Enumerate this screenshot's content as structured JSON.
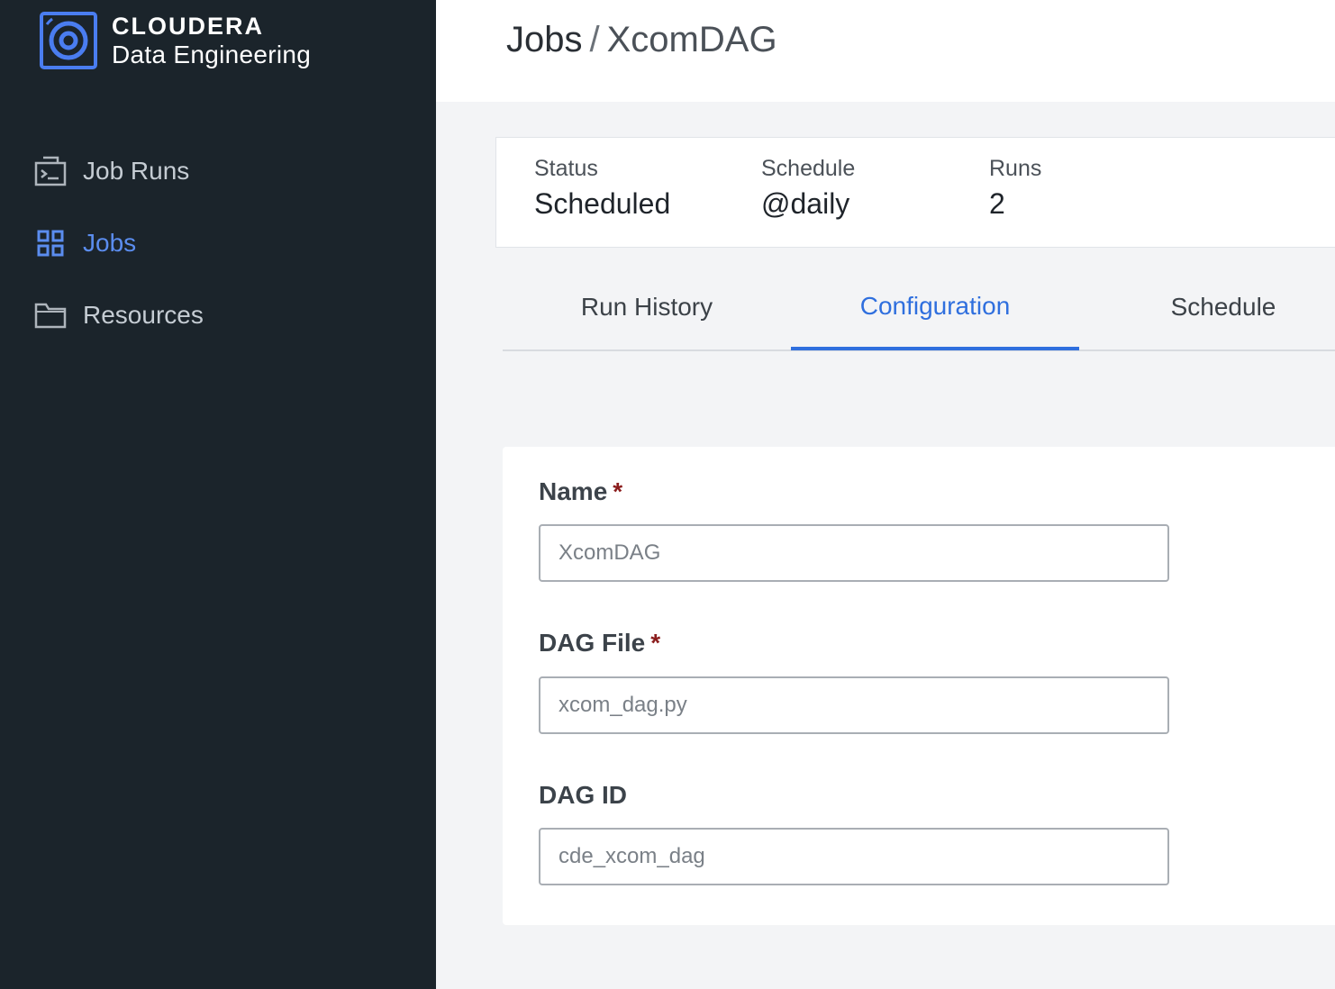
{
  "brand": {
    "name": "CLOUDERA",
    "product": "Data Engineering",
    "color": "#4a7df0"
  },
  "sidebar": {
    "items": [
      {
        "label": "Job Runs",
        "icon": "terminal-window-icon",
        "active": false
      },
      {
        "label": "Jobs",
        "icon": "grid-icon",
        "active": true
      },
      {
        "label": "Resources",
        "icon": "folder-icon",
        "active": false
      }
    ]
  },
  "header": {
    "parent": "Jobs",
    "separator": "/",
    "current": "XcomDAG"
  },
  "summary": {
    "status_label": "Status",
    "status_value": "Scheduled",
    "schedule_label": "Schedule",
    "schedule_value": "@daily",
    "runs_label": "Runs",
    "runs_value": "2"
  },
  "tabs": [
    {
      "label": "Run History",
      "active": false
    },
    {
      "label": "Configuration",
      "active": true
    },
    {
      "label": "Schedule",
      "active": false
    }
  ],
  "form": {
    "name_label": "Name",
    "name_required": "*",
    "name_value": "XcomDAG",
    "dag_file_label": "DAG File",
    "dag_file_required": "*",
    "dag_file_value": "xcom_dag.py",
    "dag_id_label": "DAG ID",
    "dag_id_value": "cde_xcom_dag"
  },
  "colors": {
    "sidebar_bg": "#1b242b",
    "accent": "#2f6fde",
    "required": "#8b1d1d"
  }
}
